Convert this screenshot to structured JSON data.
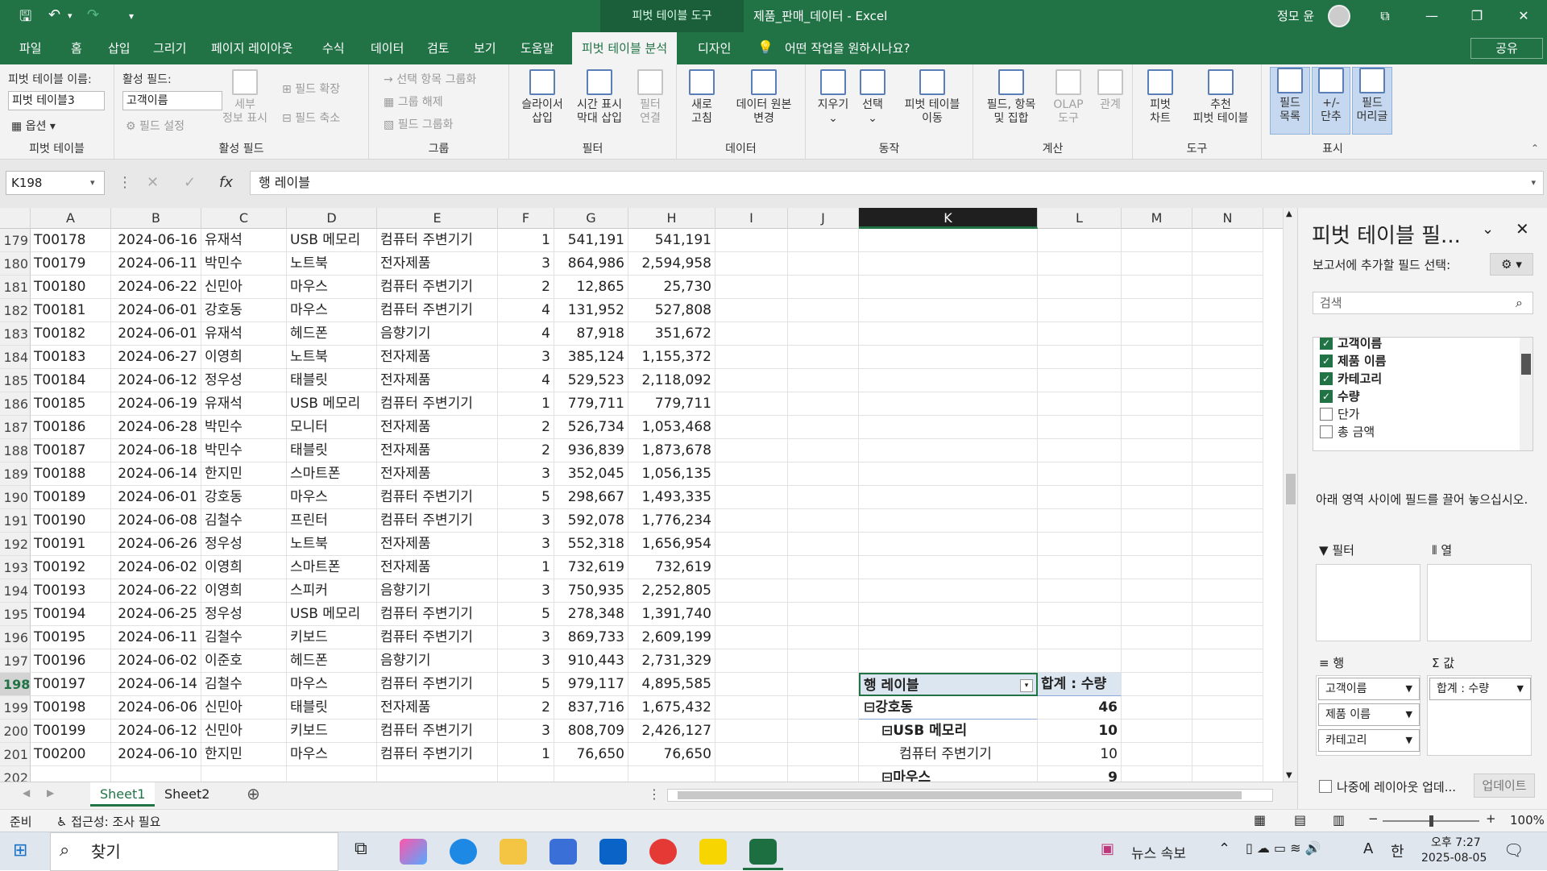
{
  "titlebar": {
    "context_tab": "피벗 테이블 도구",
    "doc_title": "제품_판매_데이터  -  Excel",
    "user": "정모 윤",
    "min": "—",
    "restore": "❐",
    "close": "✕",
    "ribbon_opt": "⧉"
  },
  "menu": {
    "tabs": [
      "파일",
      "홈",
      "삽입",
      "그리기",
      "페이지 레이아웃",
      "수식",
      "데이터",
      "검토",
      "보기",
      "도움말",
      "피벗 테이블 분석",
      "디자인"
    ],
    "tell_me": "어떤 작업을 원하시나요?",
    "share": "공유"
  },
  "ribbon": {
    "pivot": {
      "name_label": "피벗 테이블 이름:",
      "name_value": "피벗 테이블3",
      "options": "옵션",
      "group": "피벗 테이블"
    },
    "active_field": {
      "label": "활성 필드:",
      "value": "고객이름",
      "settings": "필드 설정",
      "drill": "세부\n정보 표시",
      "expand": "필드 확장",
      "collapse": "필드 축소",
      "group": "활성 필드"
    },
    "grouping": {
      "group_sel": "선택 항목 그룹화",
      "ungroup": "그룹 해제",
      "group_field": "필드 그룹화",
      "group": "그룹"
    },
    "filter": {
      "slicer": "슬라이서\n삽입",
      "timeline": "시간 표시\n막대 삽입",
      "conn": "필터\n연결",
      "group": "필터"
    },
    "data": {
      "refresh": "새로\n고침",
      "source": "데이터 원본\n변경",
      "group": "데이터"
    },
    "actions": {
      "clear": "지우기",
      "select": "선택",
      "move": "피벗 테이블\n이동",
      "group": "동작"
    },
    "calc": {
      "fields": "필드, 항목\n및 집합",
      "olap": "OLAP\n도구",
      "rel": "관계",
      "group": "계산"
    },
    "tools": {
      "chart": "피벗\n차트",
      "recommend": "추천\n피벗 테이블",
      "group": "도구"
    },
    "show": {
      "list": "필드\n목록",
      "buttons": "+/-\n단추",
      "headers": "필드\n머리글",
      "group": "표시"
    }
  },
  "formula": {
    "namebox": "K198",
    "content": "행 레이블"
  },
  "columns": [
    "A",
    "B",
    "C",
    "D",
    "E",
    "F",
    "G",
    "H",
    "I",
    "J",
    "K",
    "L",
    "M",
    "N"
  ],
  "rows": [
    {
      "r": "179",
      "a": "T00178",
      "b": "2024-06-16",
      "c": "유재석",
      "d": "USB 메모리",
      "e": "컴퓨터 주변기기",
      "f": "1",
      "g": "541,191",
      "h": "541,191"
    },
    {
      "r": "180",
      "a": "T00179",
      "b": "2024-06-11",
      "c": "박민수",
      "d": "노트북",
      "e": "전자제품",
      "f": "3",
      "g": "864,986",
      "h": "2,594,958"
    },
    {
      "r": "181",
      "a": "T00180",
      "b": "2024-06-22",
      "c": "신민아",
      "d": "마우스",
      "e": "컴퓨터 주변기기",
      "f": "2",
      "g": "12,865",
      "h": "25,730"
    },
    {
      "r": "182",
      "a": "T00181",
      "b": "2024-06-01",
      "c": "강호동",
      "d": "마우스",
      "e": "컴퓨터 주변기기",
      "f": "4",
      "g": "131,952",
      "h": "527,808"
    },
    {
      "r": "183",
      "a": "T00182",
      "b": "2024-06-01",
      "c": "유재석",
      "d": "헤드폰",
      "e": "음향기기",
      "f": "4",
      "g": "87,918",
      "h": "351,672"
    },
    {
      "r": "184",
      "a": "T00183",
      "b": "2024-06-27",
      "c": "이영희",
      "d": "노트북",
      "e": "전자제품",
      "f": "3",
      "g": "385,124",
      "h": "1,155,372"
    },
    {
      "r": "185",
      "a": "T00184",
      "b": "2024-06-12",
      "c": "정우성",
      "d": "태블릿",
      "e": "전자제품",
      "f": "4",
      "g": "529,523",
      "h": "2,118,092"
    },
    {
      "r": "186",
      "a": "T00185",
      "b": "2024-06-19",
      "c": "유재석",
      "d": "USB 메모리",
      "e": "컴퓨터 주변기기",
      "f": "1",
      "g": "779,711",
      "h": "779,711"
    },
    {
      "r": "187",
      "a": "T00186",
      "b": "2024-06-28",
      "c": "박민수",
      "d": "모니터",
      "e": "전자제품",
      "f": "2",
      "g": "526,734",
      "h": "1,053,468"
    },
    {
      "r": "188",
      "a": "T00187",
      "b": "2024-06-18",
      "c": "박민수",
      "d": "태블릿",
      "e": "전자제품",
      "f": "2",
      "g": "936,839",
      "h": "1,873,678"
    },
    {
      "r": "189",
      "a": "T00188",
      "b": "2024-06-14",
      "c": "한지민",
      "d": "스마트폰",
      "e": "전자제품",
      "f": "3",
      "g": "352,045",
      "h": "1,056,135"
    },
    {
      "r": "190",
      "a": "T00189",
      "b": "2024-06-01",
      "c": "강호동",
      "d": "마우스",
      "e": "컴퓨터 주변기기",
      "f": "5",
      "g": "298,667",
      "h": "1,493,335"
    },
    {
      "r": "191",
      "a": "T00190",
      "b": "2024-06-08",
      "c": "김철수",
      "d": "프린터",
      "e": "컴퓨터 주변기기",
      "f": "3",
      "g": "592,078",
      "h": "1,776,234"
    },
    {
      "r": "192",
      "a": "T00191",
      "b": "2024-06-26",
      "c": "정우성",
      "d": "노트북",
      "e": "전자제품",
      "f": "3",
      "g": "552,318",
      "h": "1,656,954"
    },
    {
      "r": "193",
      "a": "T00192",
      "b": "2024-06-02",
      "c": "이영희",
      "d": "스마트폰",
      "e": "전자제품",
      "f": "1",
      "g": "732,619",
      "h": "732,619"
    },
    {
      "r": "194",
      "a": "T00193",
      "b": "2024-06-22",
      "c": "이영희",
      "d": "스피커",
      "e": "음향기기",
      "f": "3",
      "g": "750,935",
      "h": "2,252,805"
    },
    {
      "r": "195",
      "a": "T00194",
      "b": "2024-06-25",
      "c": "정우성",
      "d": "USB 메모리",
      "e": "컴퓨터 주변기기",
      "f": "5",
      "g": "278,348",
      "h": "1,391,740"
    },
    {
      "r": "196",
      "a": "T00195",
      "b": "2024-06-11",
      "c": "김철수",
      "d": "키보드",
      "e": "컴퓨터 주변기기",
      "f": "3",
      "g": "869,733",
      "h": "2,609,199"
    },
    {
      "r": "197",
      "a": "T00196",
      "b": "2024-06-02",
      "c": "이준호",
      "d": "헤드폰",
      "e": "음향기기",
      "f": "3",
      "g": "910,443",
      "h": "2,731,329"
    },
    {
      "r": "198",
      "a": "T00197",
      "b": "2024-06-14",
      "c": "김철수",
      "d": "마우스",
      "e": "컴퓨터 주변기기",
      "f": "5",
      "g": "979,117",
      "h": "4,895,585"
    },
    {
      "r": "199",
      "a": "T00198",
      "b": "2024-06-06",
      "c": "신민아",
      "d": "태블릿",
      "e": "전자제품",
      "f": "2",
      "g": "837,716",
      "h": "1,675,432"
    },
    {
      "r": "200",
      "a": "T00199",
      "b": "2024-06-12",
      "c": "신민아",
      "d": "키보드",
      "e": "컴퓨터 주변기기",
      "f": "3",
      "g": "808,709",
      "h": "2,426,127"
    },
    {
      "r": "201",
      "a": "T00200",
      "b": "2024-06-10",
      "c": "한지민",
      "d": "마우스",
      "e": "컴퓨터 주변기기",
      "f": "1",
      "g": "76,650",
      "h": "76,650"
    },
    {
      "r": "202",
      "a": "",
      "b": "",
      "c": "",
      "d": "",
      "e": "",
      "f": "",
      "g": "",
      "h": ""
    }
  ],
  "pivot": {
    "row_label": "행 레이블",
    "sum_label": "합계 : 수량",
    "rows": [
      {
        "label": "⊟강호동",
        "value": "46",
        "level": 0
      },
      {
        "label": "⊟USB 메모리",
        "value": "10",
        "level": 1
      },
      {
        "label": "컴퓨터 주변기기",
        "value": "10",
        "level": 2
      },
      {
        "label": "⊟마우스",
        "value": "9",
        "level": 1
      }
    ]
  },
  "sheets": [
    "Sheet1",
    "Sheet2"
  ],
  "status": {
    "ready": "준비",
    "access": "접근성: 조사 필요",
    "zoom": "100%"
  },
  "pane": {
    "title": "피벗 테이블 필...",
    "subtitle": "보고서에 추가할 필드 선택:",
    "search_placeholder": "검색",
    "fields": [
      {
        "name": "고객이름",
        "checked": true
      },
      {
        "name": "제품 이름",
        "checked": true
      },
      {
        "name": "카테고리",
        "checked": true
      },
      {
        "name": "수량",
        "checked": true
      },
      {
        "name": "단가",
        "checked": false
      },
      {
        "name": "총 금액",
        "checked": false
      }
    ],
    "drag_hint": "아래 영역 사이에 필드를 끌어 놓으십시오.",
    "area_filter": "필터",
    "area_cols": "열",
    "area_rows": "행",
    "area_values": "값",
    "row_pills": [
      "고객이름",
      "제품 이름",
      "카테고리"
    ],
    "value_pills": [
      "합계 : 수량"
    ],
    "defer": "나중에 레이아웃 업데...",
    "update": "업데이트"
  },
  "taskbar": {
    "search": "찾기",
    "news": "뉴스 속보",
    "time": "오후 7:27",
    "date": "2025-08-05",
    "ime": "한",
    "lang": "A"
  }
}
